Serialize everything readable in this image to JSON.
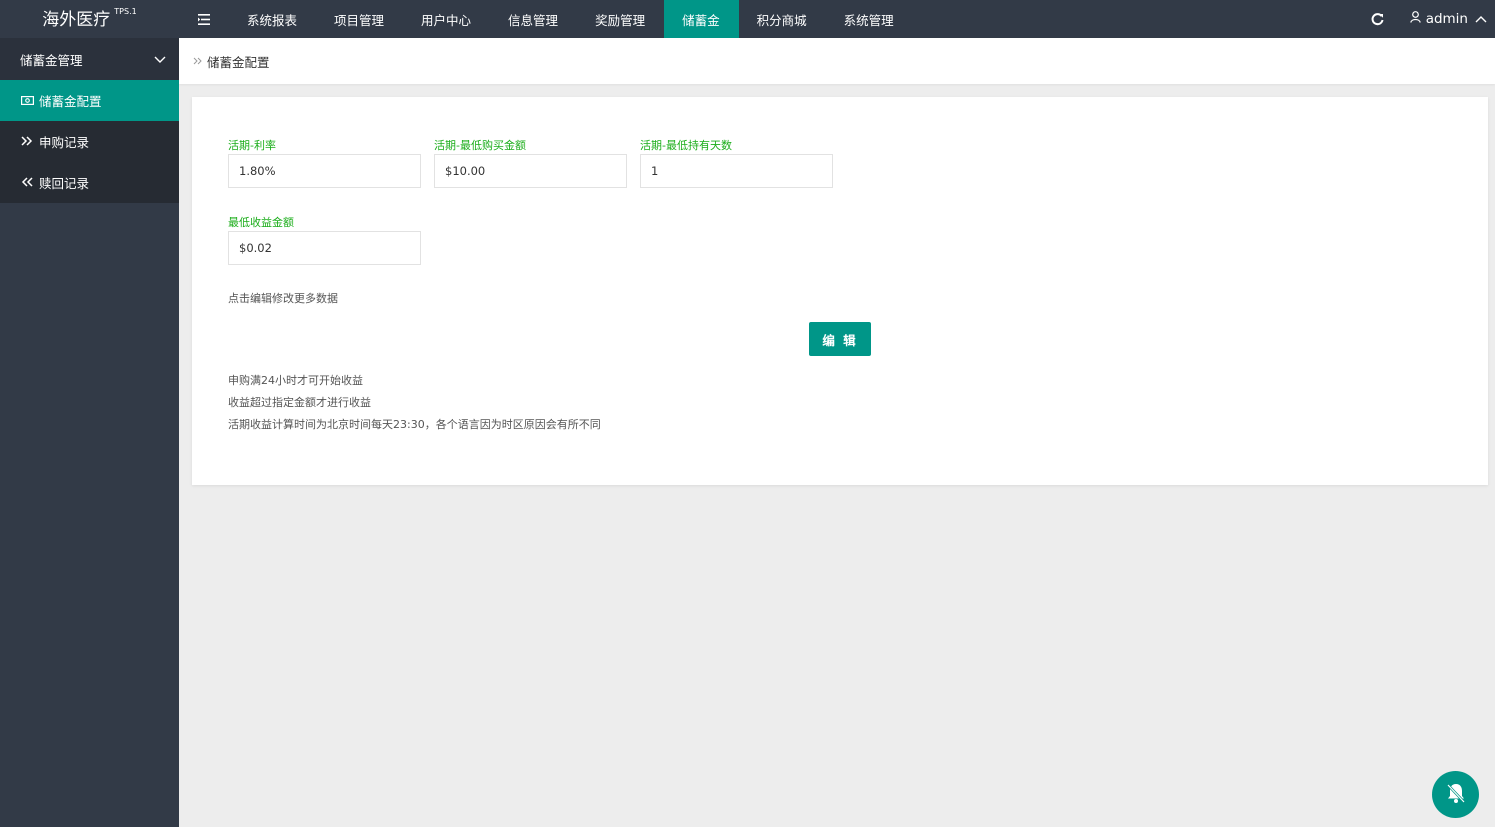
{
  "header": {
    "logo": "海外医疗",
    "logo_version": "TPS.1",
    "menu_toggle_icon": "menu-fold-icon",
    "nav": [
      {
        "label": "系统报表",
        "active": false
      },
      {
        "label": "项目管理",
        "active": false
      },
      {
        "label": "用户中心",
        "active": false
      },
      {
        "label": "信息管理",
        "active": false
      },
      {
        "label": "奖励管理",
        "active": false
      },
      {
        "label": "储蓄金",
        "active": true
      },
      {
        "label": "积分商城",
        "active": false
      },
      {
        "label": "系统管理",
        "active": false
      }
    ],
    "refresh_icon": "refresh-icon",
    "user": {
      "icon": "user-icon",
      "name": "admin",
      "caret_icon": "chevron-up-icon"
    }
  },
  "sidebar": {
    "group": {
      "label": "储蓄金管理",
      "icon": "chevron-down-icon"
    },
    "items": [
      {
        "label": "储蓄金配置",
        "icon": "money-icon",
        "active": true
      },
      {
        "label": "申购记录",
        "icon": "double-chevron-right-icon",
        "active": false
      },
      {
        "label": "赎回记录",
        "icon": "double-chevron-left-icon",
        "active": false
      }
    ]
  },
  "breadcrumb": {
    "icon": "double-chevron-right-icon",
    "label": "储蓄金配置"
  },
  "form": {
    "fields": [
      {
        "label": "活期-利率",
        "value": "1.80%"
      },
      {
        "label": "活期-最低购买金额",
        "value": "$10.00"
      },
      {
        "label": "活期-最低持有天数",
        "value": "1"
      },
      {
        "label": "最低收益金额",
        "value": "$0.02"
      }
    ],
    "hint": "点击编辑修改更多数据",
    "edit_button": "编 辑",
    "notes": [
      "申购满24小时才可开始收益",
      "收益超过指定金额才进行收益",
      "活期收益计算时间为北京时间每天23:30，各个语言因为时区原因会有所不同"
    ]
  },
  "colors": {
    "accent": "#009688",
    "header_bg": "#323a47",
    "label_green": "#1aad19"
  }
}
